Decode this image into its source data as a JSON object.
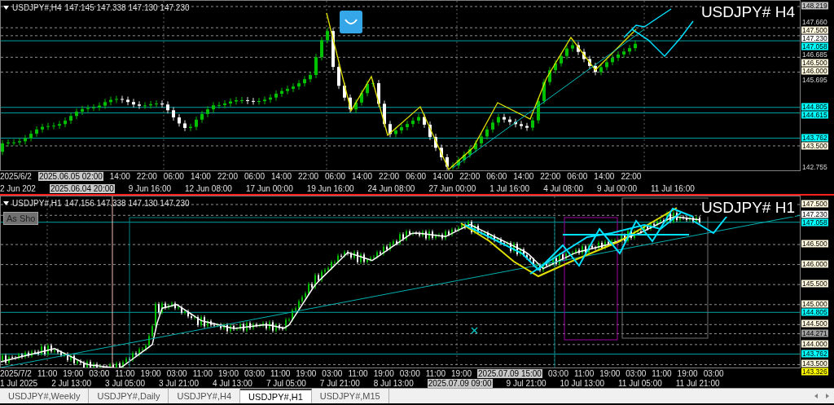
{
  "charts": [
    {
      "header": {
        "symbol": "USDJPY#,H4",
        "quotes": "147.145 147.338 147.130 147.230"
      },
      "title": "USDJPY# H4",
      "price_axis": [
        {
          "text": "148.219",
          "kind": "badge",
          "color": "#c0c0c0"
        },
        {
          "text": "147.660",
          "kind": "tick"
        },
        {
          "text": "147.500",
          "kind": "badge",
          "color": "#fff8dc"
        },
        {
          "text": "147.230",
          "kind": "badge",
          "color": "#ffffff"
        },
        {
          "text": "147.058",
          "kind": "badge",
          "color": "#00ffff"
        },
        {
          "text": "146.685",
          "kind": "tick"
        },
        {
          "text": "146.500",
          "kind": "badge",
          "color": "#fff8dc"
        },
        {
          "text": "146.000",
          "kind": "badge",
          "color": "#fff8dc"
        },
        {
          "text": "145.695",
          "kind": "tick"
        },
        {
          "text": "144.805",
          "kind": "badge",
          "color": "#00ffff"
        },
        {
          "text": "144.615",
          "kind": "badge",
          "color": "#00ffff"
        },
        {
          "text": "143.762",
          "kind": "badge",
          "color": "#00ffff"
        },
        {
          "text": "143.500",
          "kind": "badge",
          "color": "#fff8dc"
        },
        {
          "text": "142.755",
          "kind": "tick"
        }
      ],
      "time_axis_upper": [
        {
          "text": "2025/6/2",
          "kind": "tick"
        },
        {
          "text": "2025.06.05 02:00",
          "kind": "badge"
        },
        {
          "text": "14:00",
          "kind": "tick"
        },
        {
          "text": "22:00",
          "kind": "tick"
        },
        {
          "text": "06:00",
          "kind": "tick"
        },
        {
          "text": "14:00",
          "kind": "tick"
        },
        {
          "text": "22:00",
          "kind": "tick"
        },
        {
          "text": "06:00",
          "kind": "tick"
        },
        {
          "text": "14:00",
          "kind": "tick"
        },
        {
          "text": "22:00",
          "kind": "tick"
        },
        {
          "text": "06:00",
          "kind": "tick"
        },
        {
          "text": "14:00",
          "kind": "tick"
        },
        {
          "text": "22:00",
          "kind": "tick"
        },
        {
          "text": "06:00",
          "kind": "tick"
        },
        {
          "text": "14:00",
          "kind": "tick"
        },
        {
          "text": "22:00",
          "kind": "tick"
        },
        {
          "text": "06:00",
          "kind": "tick"
        },
        {
          "text": "14:00",
          "kind": "tick"
        },
        {
          "text": "22:00",
          "kind": "tick"
        },
        {
          "text": "06:00",
          "kind": "tick"
        },
        {
          "text": "14:00",
          "kind": "tick"
        },
        {
          "text": "22:00",
          "kind": "tick"
        }
      ],
      "time_axis_lower": [
        {
          "text": "2 Jun 202",
          "kind": "tick"
        },
        {
          "text": "2025.06.04 20:00",
          "kind": "badge"
        },
        {
          "text": "9 Jun 16:00",
          "kind": "tick"
        },
        {
          "text": "12 Jun 08:00",
          "kind": "tick"
        },
        {
          "text": "17 Jun 00:00",
          "kind": "tick"
        },
        {
          "text": "19 Jun 16:00",
          "kind": "tick"
        },
        {
          "text": "24 Jun 08:00",
          "kind": "tick"
        },
        {
          "text": "27 Jun 00:00",
          "kind": "tick"
        },
        {
          "text": "1 Jul 16:00",
          "kind": "tick"
        },
        {
          "text": "4 Jul 08:00",
          "kind": "tick"
        },
        {
          "text": "9 Jul 00:00",
          "kind": "tick"
        },
        {
          "text": "11 Jul 16:00",
          "kind": "tick"
        }
      ]
    },
    {
      "header": {
        "symbol": "USDJPY#,H1",
        "quotes": "147.156 147.338 147.130 147.230"
      },
      "title": "USDJPY# H1",
      "button": "As Sho",
      "price_axis": [
        {
          "text": "147.500",
          "kind": "badge",
          "color": "#fff8dc"
        },
        {
          "text": "147.230",
          "kind": "badge",
          "color": "#ffffff"
        },
        {
          "text": "147.058",
          "kind": "badge",
          "color": "#00ffff"
        },
        {
          "text": "146.500",
          "kind": "badge",
          "color": "#fff8dc"
        },
        {
          "text": "146.000",
          "kind": "badge",
          "color": "#fff8dc"
        },
        {
          "text": "145.500",
          "kind": "badge",
          "color": "#fff8dc"
        },
        {
          "text": "145.000",
          "kind": "badge",
          "color": "#fff8dc"
        },
        {
          "text": "144.805",
          "kind": "badge",
          "color": "#00ffff"
        },
        {
          "text": "144.500",
          "kind": "badge",
          "color": "#fff8dc"
        },
        {
          "text": "144.271",
          "kind": "badge",
          "color": "#a0a0a0"
        },
        {
          "text": "144.000",
          "kind": "badge",
          "color": "#fff8dc"
        },
        {
          "text": "143.762",
          "kind": "badge",
          "color": "#00ffff"
        },
        {
          "text": "143.500",
          "kind": "badge",
          "color": "#fff8dc"
        },
        {
          "text": "143.326",
          "kind": "badge",
          "color": "#ffff00"
        }
      ],
      "time_axis_upper": [
        {
          "text": "2025/7/2",
          "kind": "tick"
        },
        {
          "text": "11:00",
          "kind": "tick"
        },
        {
          "text": "19:00",
          "kind": "tick"
        },
        {
          "text": "03:00",
          "kind": "tick"
        },
        {
          "text": "11:00",
          "kind": "tick"
        },
        {
          "text": "19:00",
          "kind": "tick"
        },
        {
          "text": "03:00",
          "kind": "tick"
        },
        {
          "text": "11:00",
          "kind": "tick"
        },
        {
          "text": "19:00",
          "kind": "tick"
        },
        {
          "text": "03:00",
          "kind": "tick"
        },
        {
          "text": "11:00",
          "kind": "tick"
        },
        {
          "text": "19:00",
          "kind": "tick"
        },
        {
          "text": "03:00",
          "kind": "tick"
        },
        {
          "text": "11:00",
          "kind": "tick"
        },
        {
          "text": "19:00",
          "kind": "tick"
        },
        {
          "text": "03:00",
          "kind": "tick"
        },
        {
          "text": "11:00",
          "kind": "tick"
        },
        {
          "text": "19:00",
          "kind": "tick"
        },
        {
          "text": "2025.07.09 15:00",
          "kind": "badge"
        },
        {
          "text": "03:00",
          "kind": "tick"
        },
        {
          "text": "11:00",
          "kind": "tick"
        },
        {
          "text": "19:00",
          "kind": "tick"
        },
        {
          "text": "03:00",
          "kind": "tick"
        },
        {
          "text": "11:00",
          "kind": "tick"
        },
        {
          "text": "19:00",
          "kind": "tick"
        },
        {
          "text": "03:00",
          "kind": "tick"
        }
      ],
      "time_axis_lower": [
        {
          "text": "1 Jul 2025",
          "kind": "tick"
        },
        {
          "text": "2 Jul 13:00",
          "kind": "tick"
        },
        {
          "text": "3 Jul 05:00",
          "kind": "tick"
        },
        {
          "text": "3 Jul 21:00",
          "kind": "tick"
        },
        {
          "text": "4 Jul 13:00",
          "kind": "tick"
        },
        {
          "text": "7 Jul 05:00",
          "kind": "tick"
        },
        {
          "text": "7 Jul 21:00",
          "kind": "tick"
        },
        {
          "text": "8 Jul 13:00",
          "kind": "tick"
        },
        {
          "text": "2025.07.09 09:00",
          "kind": "badge"
        },
        {
          "text": "9 Jul 21:00",
          "kind": "tick"
        },
        {
          "text": "10 Jul 13:00",
          "kind": "tick"
        },
        {
          "text": "11 Jul 05:00",
          "kind": "tick"
        },
        {
          "text": "11 Jul 21:00",
          "kind": "tick"
        }
      ]
    }
  ],
  "tabs": [
    {
      "label": "USDJPY#,Weekly",
      "selected": false
    },
    {
      "label": "USDJPY#,Daily",
      "selected": false
    },
    {
      "label": "USDJPY#,H4",
      "selected": false
    },
    {
      "label": "USDJPY#,H1",
      "selected": true
    },
    {
      "label": "USDJPY#,M15",
      "selected": false
    }
  ]
}
